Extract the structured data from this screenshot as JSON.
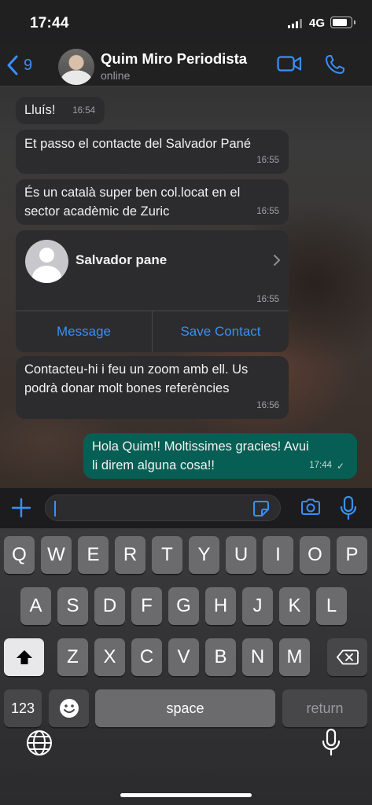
{
  "status_bar": {
    "time": "17:44",
    "network": "4G",
    "battery_level": 0.85
  },
  "header": {
    "back_count": "9",
    "contact_name": "Quim Miro Periodista",
    "contact_status": "online"
  },
  "messages": [
    {
      "text": "Lluís!",
      "time": "16:54",
      "direction": "in"
    },
    {
      "text": "Et passo el contacte del Salvador Pané",
      "time": "16:55",
      "direction": "in"
    },
    {
      "line1": "És un català super ben col.locat en el",
      "line2": "sector acadèmic de Zuric",
      "time": "16:55",
      "direction": "in"
    },
    {
      "line1": "Contacteu-hi i feu un zoom amb ell. Us",
      "line2": "podrà donar molt bones referències",
      "time": "16:56",
      "direction": "in"
    },
    {
      "line1": "Hola Quim!! Moltissimes gracies! Avui",
      "line2": "li direm alguna cosa!!",
      "time": "17:44",
      "direction": "out",
      "status": "✓"
    }
  ],
  "contact_card": {
    "name": "Salvador pane",
    "time": "16:55",
    "message_label": "Message",
    "save_label": "Save Contact"
  },
  "input": {
    "value": ""
  },
  "keyboard": {
    "row1": [
      "Q",
      "W",
      "E",
      "R",
      "T",
      "Y",
      "U",
      "I",
      "O",
      "P"
    ],
    "row2": [
      "A",
      "S",
      "D",
      "F",
      "G",
      "H",
      "J",
      "K",
      "L"
    ],
    "row3": [
      "Z",
      "X",
      "C",
      "V",
      "B",
      "N",
      "M"
    ],
    "numbers_label": "123",
    "space_label": "space",
    "return_label": "return"
  },
  "colors": {
    "accent": "#3a8ff5",
    "incoming_bubble": "#2c2c2e",
    "outgoing_bubble": "#075e54"
  }
}
